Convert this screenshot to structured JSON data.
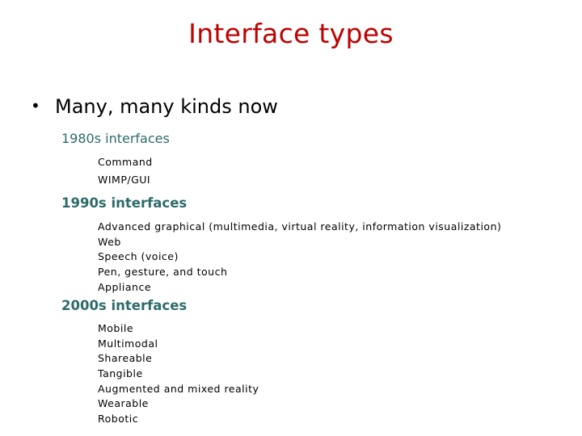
{
  "slide": {
    "title": "Interface types",
    "title_color": "#c00000",
    "heading_color": "#2e6b6b",
    "bullet_glyph": "•",
    "main_bullet": "Many, many kinds now",
    "sections": [
      {
        "heading": "1980s interfaces",
        "items": [
          "Command",
          "WIMP/GUI"
        ]
      },
      {
        "heading": "1990s interfaces",
        "items": [
          "Advanced graphical (multimedia, virtual reality, information visualization)",
          "Web",
          "Speech (voice)",
          "Pen, gesture, and touch",
          "Appliance"
        ]
      },
      {
        "heading": "2000s interfaces",
        "items": [
          "Mobile",
          "Multimodal",
          "Shareable",
          "Tangible",
          "Augmented and mixed reality",
          "Wearable",
          "Robotic"
        ]
      }
    ]
  }
}
